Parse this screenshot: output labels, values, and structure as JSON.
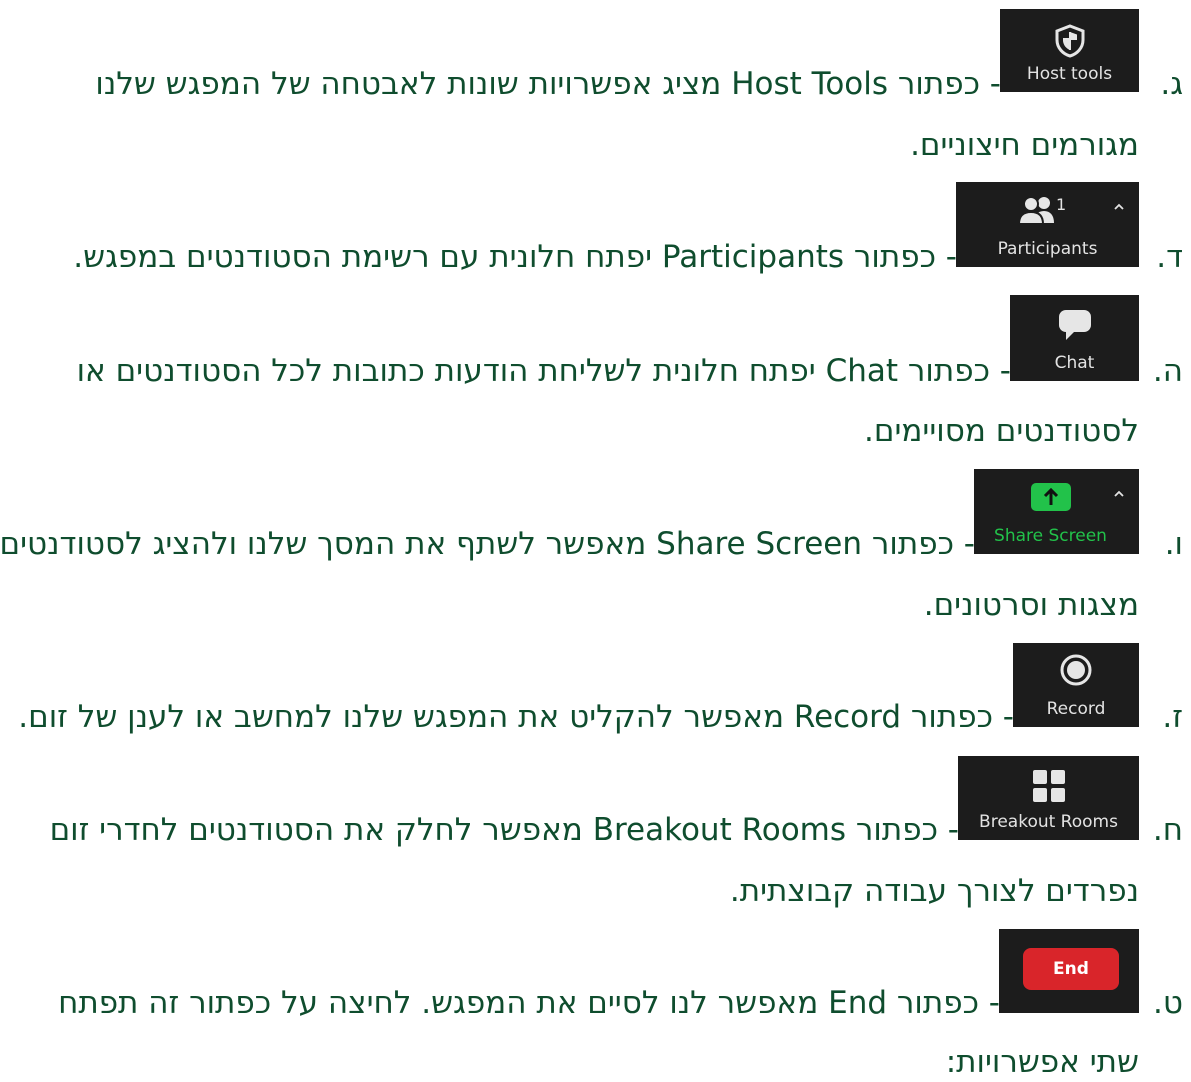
{
  "items": [
    {
      "letter": "ג.",
      "button_label": "Host tools",
      "icon": "shield-icon",
      "line1_prefix": "- כפתור ",
      "line1_term": "Host Tools",
      "line1_rest": " מציג אפשרויות שונות לאבטחה של המפגש שלנו",
      "line2": "מגורמים חיצוניים."
    },
    {
      "letter": "ד.",
      "button_label": "Participants",
      "button_count": "1",
      "icon": "participants-icon",
      "line1_prefix": "- כפתור ",
      "line1_term": "Participants",
      "line1_rest": " יפתח חלונית עם רשימת הסטודנטים במפגש."
    },
    {
      "letter": "ה.",
      "button_label": "Chat",
      "icon": "chat-bubble-icon",
      "line1_prefix": "- כפתור ",
      "line1_term": "Chat",
      "line1_rest": " יפתח חלונית לשליחת הודעות כתובות לכל הסטודנטים או",
      "line2": "לסטודנטים מסויימים."
    },
    {
      "letter": "ו.",
      "button_label": "Share Screen",
      "icon": "share-screen-icon",
      "line1_prefix": "- כפתור ",
      "line1_term": "Share Screen",
      "line1_rest": " מאפשר לשתף את המסך שלנו ולהציג לסטודנטים",
      "line2": "מצגות וסרטונים."
    },
    {
      "letter": "ז.",
      "button_label": "Record",
      "icon": "record-icon",
      "line1_prefix": "- כפתור ",
      "line1_term": "Record",
      "line1_rest": " מאפשר להקליט את המפגש שלנו למחשב או לענן של זום."
    },
    {
      "letter": "ח.",
      "button_label": "Breakout Rooms",
      "icon": "breakout-rooms-icon",
      "line1_prefix": "- כפתור ",
      "line1_term": "Breakout Rooms",
      "line1_rest": " מאפשר לחלק את הסטודנטים לחדרי זום",
      "line2": "נפרדים לצורך עבודה קבוצתית."
    },
    {
      "letter": "ט.",
      "button_label": "End",
      "icon": "end-button",
      "line1_prefix": "- כפתור ",
      "line1_term": "End",
      "line1_rest": " מאפשר לנו לסיים את המפגש. לחיצה על כפתור זה תפתח",
      "line2": "שתי אפשרויות:"
    }
  ],
  "colors": {
    "text": "#0f4d2e",
    "button_bg": "#1c1c1c",
    "share_green": "#22c24a",
    "end_red": "#d9252a"
  }
}
